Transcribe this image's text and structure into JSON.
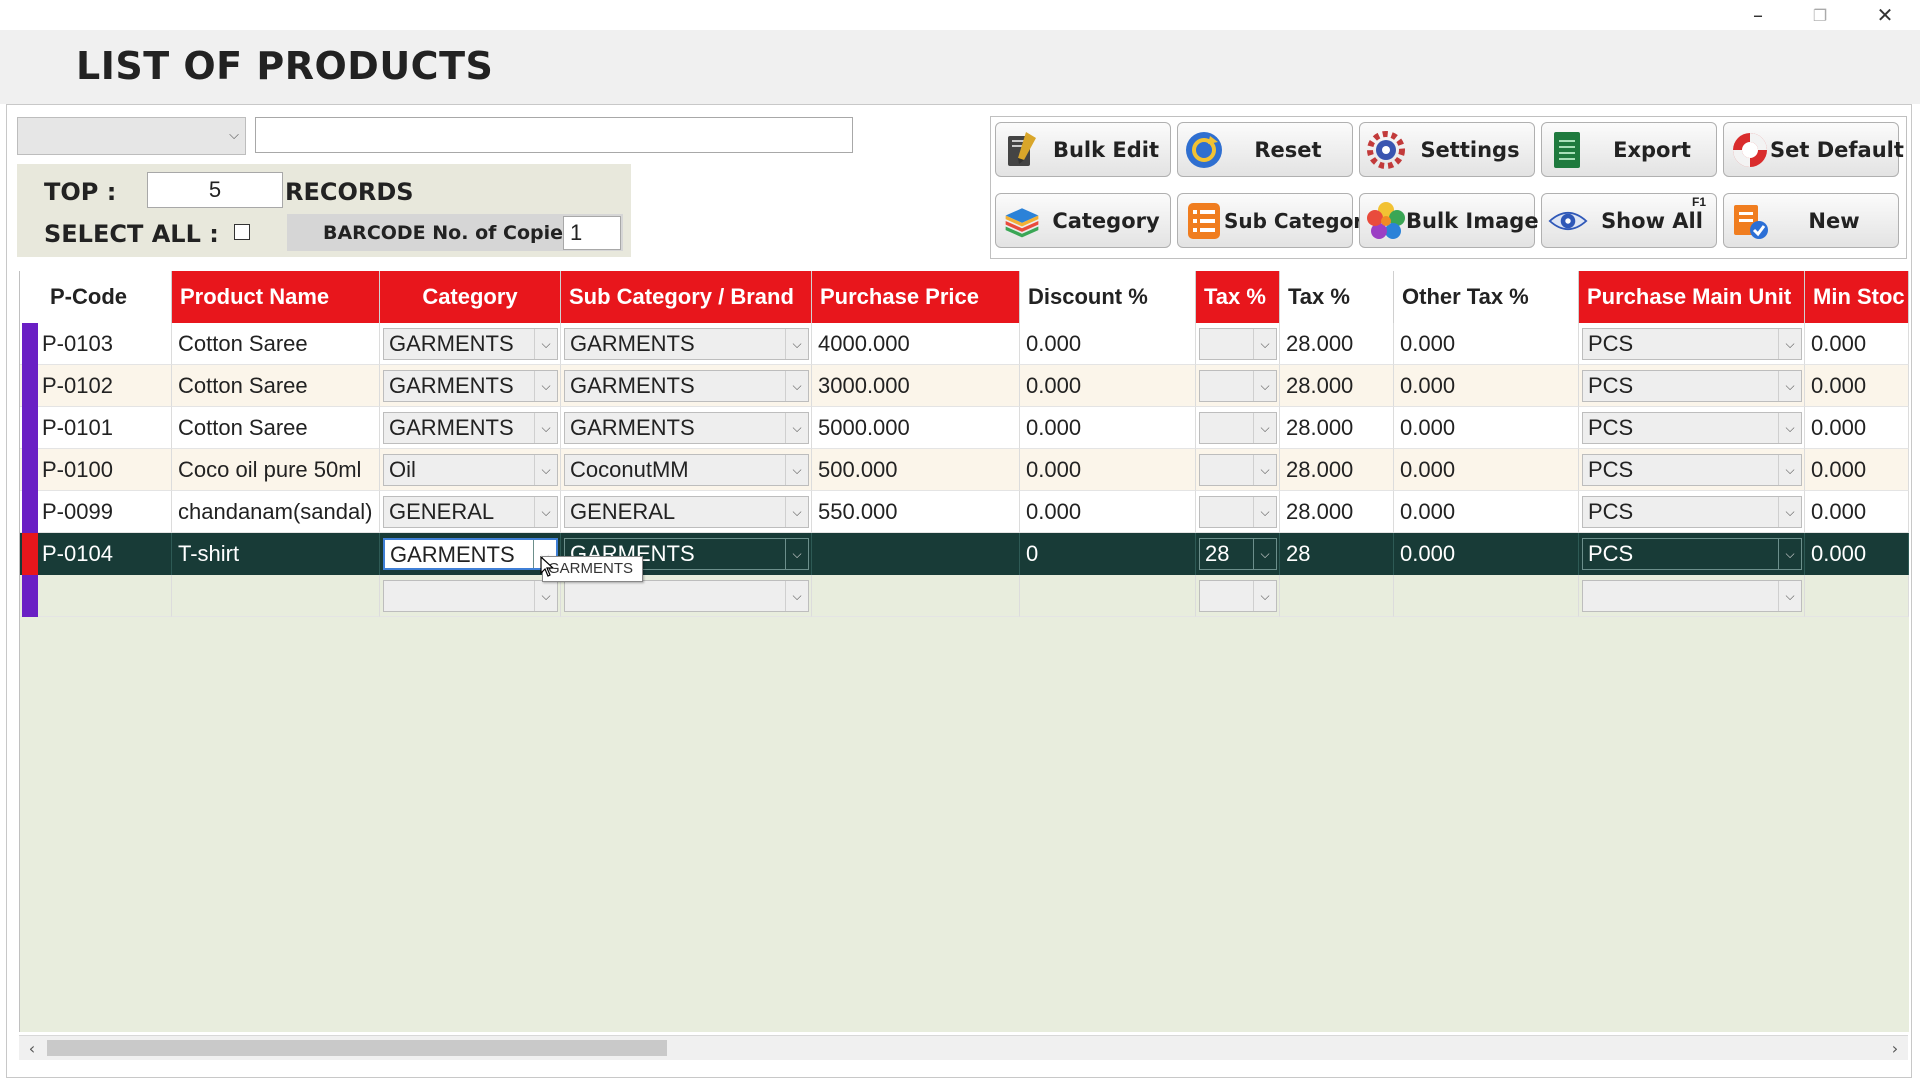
{
  "window": {
    "minimize": "–",
    "restore": "❐",
    "close": "✕"
  },
  "header": {
    "title": "LIST OF PRODUCTS"
  },
  "filters": {
    "search_value": "",
    "combo_value": ""
  },
  "top_panel": {
    "top_label": "TOP :",
    "top_value": "5",
    "records_label": "RECORDS",
    "select_all_label": "SELECT ALL :",
    "barcode_label": "BARCODE No. of Copies :",
    "barcode_value": "1"
  },
  "toolbar": {
    "bulk_edit": "Bulk Edit",
    "reset": "Reset",
    "settings": "Settings",
    "export": "Export",
    "set_default": "Set Default",
    "category": "Category",
    "sub_category": "Sub Category",
    "bulk_image": "Bulk Image",
    "show_all": "Show All",
    "show_all_key": "F1",
    "new": "New"
  },
  "grid": {
    "columns": [
      "P-Code",
      "Product Name",
      "Category",
      "Sub Category / Brand",
      "Purchase Price",
      "Discount %",
      "Tax %",
      "Tax %",
      "Other Tax %",
      "Purchase Main Unit",
      "Min Stoc"
    ],
    "rows": [
      {
        "code": "P-0103",
        "name": "Cotton Saree",
        "category": "GARMENTS",
        "subcat": "GARMENTS",
        "price": "4000.000",
        "discount": "0.000",
        "tax_dd": "",
        "tax": "28.000",
        "other_tax": "0.000",
        "unit": "PCS",
        "min_stock": "0.000"
      },
      {
        "code": "P-0102",
        "name": "Cotton Saree",
        "category": "GARMENTS",
        "subcat": "GARMENTS",
        "price": "3000.000",
        "discount": "0.000",
        "tax_dd": "",
        "tax": "28.000",
        "other_tax": "0.000",
        "unit": "PCS",
        "min_stock": "0.000"
      },
      {
        "code": "P-0101",
        "name": "Cotton Saree",
        "category": "GARMENTS",
        "subcat": "GARMENTS",
        "price": "5000.000",
        "discount": "0.000",
        "tax_dd": "",
        "tax": "28.000",
        "other_tax": "0.000",
        "unit": "PCS",
        "min_stock": "0.000"
      },
      {
        "code": "P-0100",
        "name": "Coco oil pure 50ml",
        "category": "Oil",
        "subcat": "CoconutMM",
        "price": "500.000",
        "discount": "0.000",
        "tax_dd": "",
        "tax": "28.000",
        "other_tax": "0.000",
        "unit": "PCS",
        "min_stock": "0.000"
      },
      {
        "code": "P-0099",
        "name": "chandanam(sandal)",
        "category": "GENERAL",
        "subcat": "GENERAL",
        "price": "550.000",
        "discount": "0.000",
        "tax_dd": "",
        "tax": "28.000",
        "other_tax": "0.000",
        "unit": "PCS",
        "min_stock": "0.000"
      },
      {
        "code": "P-0104",
        "name": "T-shirt",
        "category": "GARMENTS",
        "subcat": "GARMENTS",
        "price": "",
        "discount": "0",
        "tax_dd": "28",
        "tax": "28",
        "other_tax": "0.000",
        "unit": "PCS",
        "min_stock": "0.000"
      },
      {
        "code": "",
        "name": "",
        "category": "",
        "subcat": "",
        "price": "",
        "discount": "",
        "tax_dd": "",
        "tax": "",
        "other_tax": "",
        "unit": "",
        "min_stock": ""
      }
    ],
    "tooltip": "GARMENTS"
  },
  "colors": {
    "header_red": "#e8161c",
    "selected_row": "#183b37",
    "row_marker": "#6a1fc4",
    "grid_bg": "#e8eddd",
    "alt_row": "#fbf5ea"
  }
}
